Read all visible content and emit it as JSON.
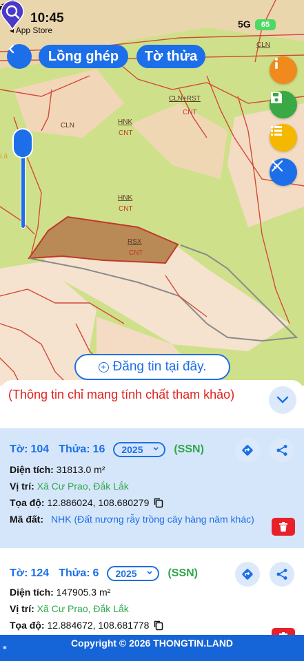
{
  "status_bar": {
    "time": "10:45",
    "back_to": "App Store",
    "network": "5G",
    "battery": "65"
  },
  "header": {
    "buttons": [
      "Lồng ghép",
      "Tờ thửa"
    ]
  },
  "map": {
    "labels": [
      "CLN",
      "CLN+RST",
      "CNT",
      "CLN",
      "HNK",
      "CNT",
      "HNK",
      "CNT",
      "RSX",
      "CNT",
      "Lâ"
    ],
    "post_button": "Đăng tin tại đây."
  },
  "panel": {
    "notice": "(Thông tin chỉ mang tính chất tham khảo)",
    "cards": [
      {
        "to_label": "Tờ:",
        "to": "104",
        "thua_label": "Thửa:",
        "thua": "16",
        "year": "2025",
        "tag": "(SSN)",
        "dien_tich_label": "Diện tích:",
        "dien_tich": "31813.0 m²",
        "vi_tri_label": "Vị trí:",
        "vi_tri": "Xã Cư Prao, Đắk Lắk",
        "toa_do_label": "Tọa độ:",
        "toa_do": "12.886024, 108.680279",
        "ma_dat_label": "Mã đất:",
        "ma_dat": "NHK (Đất nương rẫy trồng cây hàng năm khác)"
      },
      {
        "to_label": "Tờ:",
        "to": "124",
        "thua_label": "Thửa:",
        "thua": "6",
        "year": "2025",
        "tag": "(SSN)",
        "dien_tich_label": "Diện tích:",
        "dien_tich": "147905.3 m²",
        "vi_tri_label": "Vị trí:",
        "vi_tri": "Xã Cư Prao, Đắk Lắk",
        "toa_do_label": "Tọa độ:",
        "toa_do": "12.884672, 108.681778"
      }
    ]
  },
  "footer": {
    "copyright": "Copyright © 2026 THONGTIN.LAND"
  },
  "colors": {
    "primary": "#1c6fe8",
    "accent_green": "#2ea84a",
    "danger": "#e8202a",
    "map_green": "#cfe08a",
    "map_tan": "#f2d6b8"
  }
}
